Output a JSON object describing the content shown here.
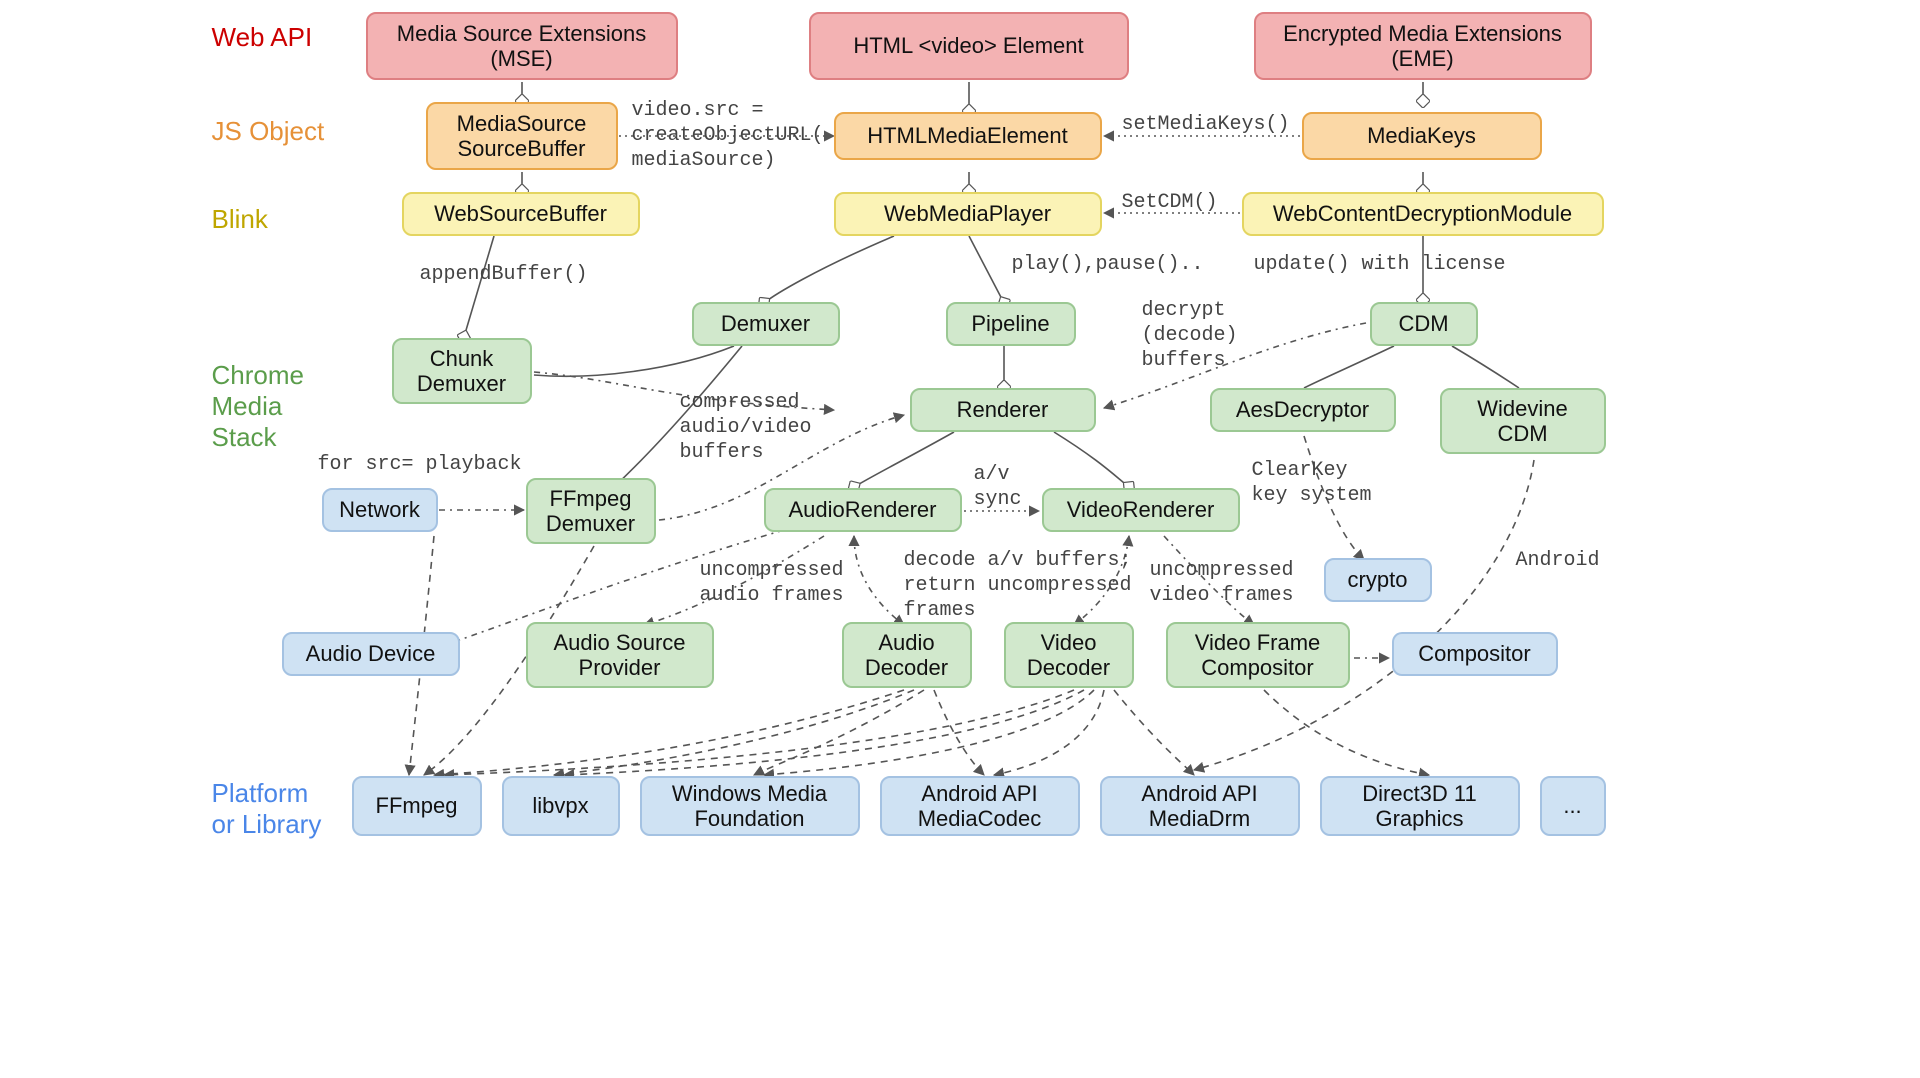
{
  "rowLabels": {
    "webapi": "Web API",
    "jsobject": "JS Object",
    "blink": "Blink",
    "chromeMedia": "Chrome\nMedia\nStack",
    "platform": "Platform\nor Library"
  },
  "nodes": {
    "mse": "Media Source Extensions\n(MSE)",
    "videoEl": "HTML <video> Element",
    "eme": "Encrypted Media Extensions\n(EME)",
    "mediaSource": "MediaSource\nSourceBuffer",
    "htmlMedia": "HTMLMediaElement",
    "mediaKeys": "MediaKeys",
    "webSourceBuffer": "WebSourceBuffer",
    "webMediaPlayer": "WebMediaPlayer",
    "webCDM": "WebContentDecryptionModule",
    "chunkDemuxer": "Chunk\nDemuxer",
    "demuxer": "Demuxer",
    "pipeline": "Pipeline",
    "cdm": "CDM",
    "renderer": "Renderer",
    "aesDecryptor": "AesDecryptor",
    "widevine": "Widevine\nCDM",
    "network": "Network",
    "ffmpegDemuxer": "FFmpeg\nDemuxer",
    "audioRenderer": "AudioRenderer",
    "videoRenderer": "VideoRenderer",
    "crypto": "crypto",
    "audioDevice": "Audio Device",
    "audioSourceProvider": "Audio Source\nProvider",
    "audioDecoder": "Audio\nDecoder",
    "videoDecoder": "Video\nDecoder",
    "videoFrameCompositor": "Video Frame\nCompositor",
    "compositor": "Compositor",
    "ffmpeg": "FFmpeg",
    "libvpx": "libvpx",
    "wmf": "Windows Media\nFoundation",
    "androidCodec": "Android API\nMediaCodec",
    "androidDrm": "Android API\nMediaDrm",
    "d3d11": "Direct3D 11\nGraphics",
    "more": "..."
  },
  "notes": {
    "createObjectURL": "video.src =\ncreateObjectURL(\nmediaSource)",
    "setMediaKeys": "setMediaKeys()",
    "setCDM": "SetCDM()",
    "appendBuffer": "appendBuffer()",
    "playPause": "play(),pause()..",
    "updateLicense": "update() with license",
    "decryptBuffers": "decrypt\n(decode)\nbuffers",
    "compressed": "compressed\naudio/video\nbuffers",
    "forSrc": "for src= playback",
    "clearKey": "ClearKey\nkey system",
    "avSync": "a/v\nsync",
    "uncompAudio": "uncompressed\naudio frames",
    "decodeAV": "decode a/v buffers;\nreturn uncompressed\nframes",
    "uncompVideo": "uncompressed\nvideo frames",
    "android": "Android"
  }
}
